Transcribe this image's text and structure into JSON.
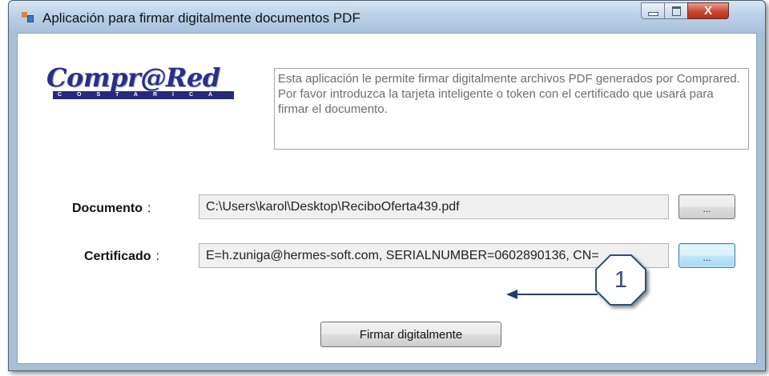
{
  "window": {
    "title": "Aplicación para firmar digitalmente documentos PDF",
    "controls": {
      "close_glyph": "X"
    }
  },
  "logo": {
    "name": "Compr@Red",
    "subtitle": "COSTARICA"
  },
  "description": "Esta aplicación le permite firmar digitalmente archivos PDF generados por Comprared.\nPor favor introduzca la tarjeta inteligente o token con el certificado que usará para firmar el documento.",
  "fields": {
    "document": {
      "label": "Documento",
      "value": "C:\\Users\\karol\\Desktop\\ReciboOferta439.pdf",
      "browse_label": "..."
    },
    "certificate": {
      "label": "Certificado",
      "value": "E=h.zuniga@hermes-soft.com, SERIALNUMBER=0602890136, CN=",
      "browse_label": "..."
    },
    "colon": ":"
  },
  "actions": {
    "sign_label": "Firmar digitalmente"
  },
  "annotation": {
    "callout_number": "1"
  },
  "icons": {
    "app": "app-window-icon",
    "minimize": "minimize-icon",
    "maximize": "maximize-icon",
    "close": "close-icon",
    "pointer": "arrow-left-icon"
  },
  "colors": {
    "titlebar": "#bcd1e8",
    "close_button": "#c8472f",
    "logo_blue": "#2b2f86",
    "callout_text": "#2d4f79",
    "arrow": "#1f3f6a"
  }
}
